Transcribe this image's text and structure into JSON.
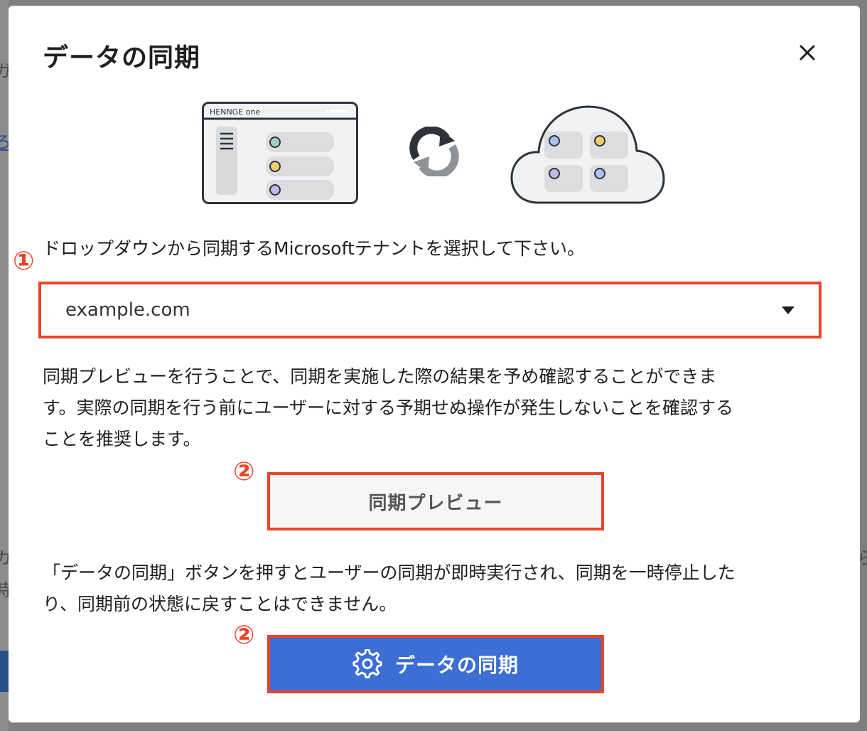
{
  "background": {
    "left_texts": [
      "ガ",
      "ろ",
      "カ",
      "時"
    ],
    "right_texts": [
      "ら"
    ]
  },
  "modal": {
    "title": "データの同期",
    "close_icon": "close-icon",
    "illustration": {
      "app_window_brand": "HENNGE one",
      "sync_icon": "sync-icon",
      "cloud_icon": "cloud-icon"
    },
    "step1_marker": "①",
    "instruction": "ドロップダウンから同期するMicrosoftテナントを選択して下さい。",
    "tenant_select": {
      "value": "example.com",
      "icon": "chevron-down-icon"
    },
    "preview_description": [
      "同期プレビューを行うことで、同期を実施した際の結果を予め確認することができま",
      "す。実際の同期を行う前にユーザーに対する予期せぬ操作が発生しないことを確認する",
      "ことを推奨します。"
    ],
    "step2_marker": "②",
    "preview_button_label": "同期プレビュー",
    "sync_warning": [
      "「データの同期」ボタンを押すとユーザーの同期が即時実行され、同期を一時停止した",
      "り、同期前の状態に戻すことはできません。"
    ],
    "step2_marker_b": "②",
    "sync_button": {
      "label": "データの同期",
      "icon": "gear-icon"
    }
  },
  "colors": {
    "accent_red": "#e8442b",
    "primary_blue": "#3c6ed3",
    "overlay": "#7f7f7f"
  }
}
